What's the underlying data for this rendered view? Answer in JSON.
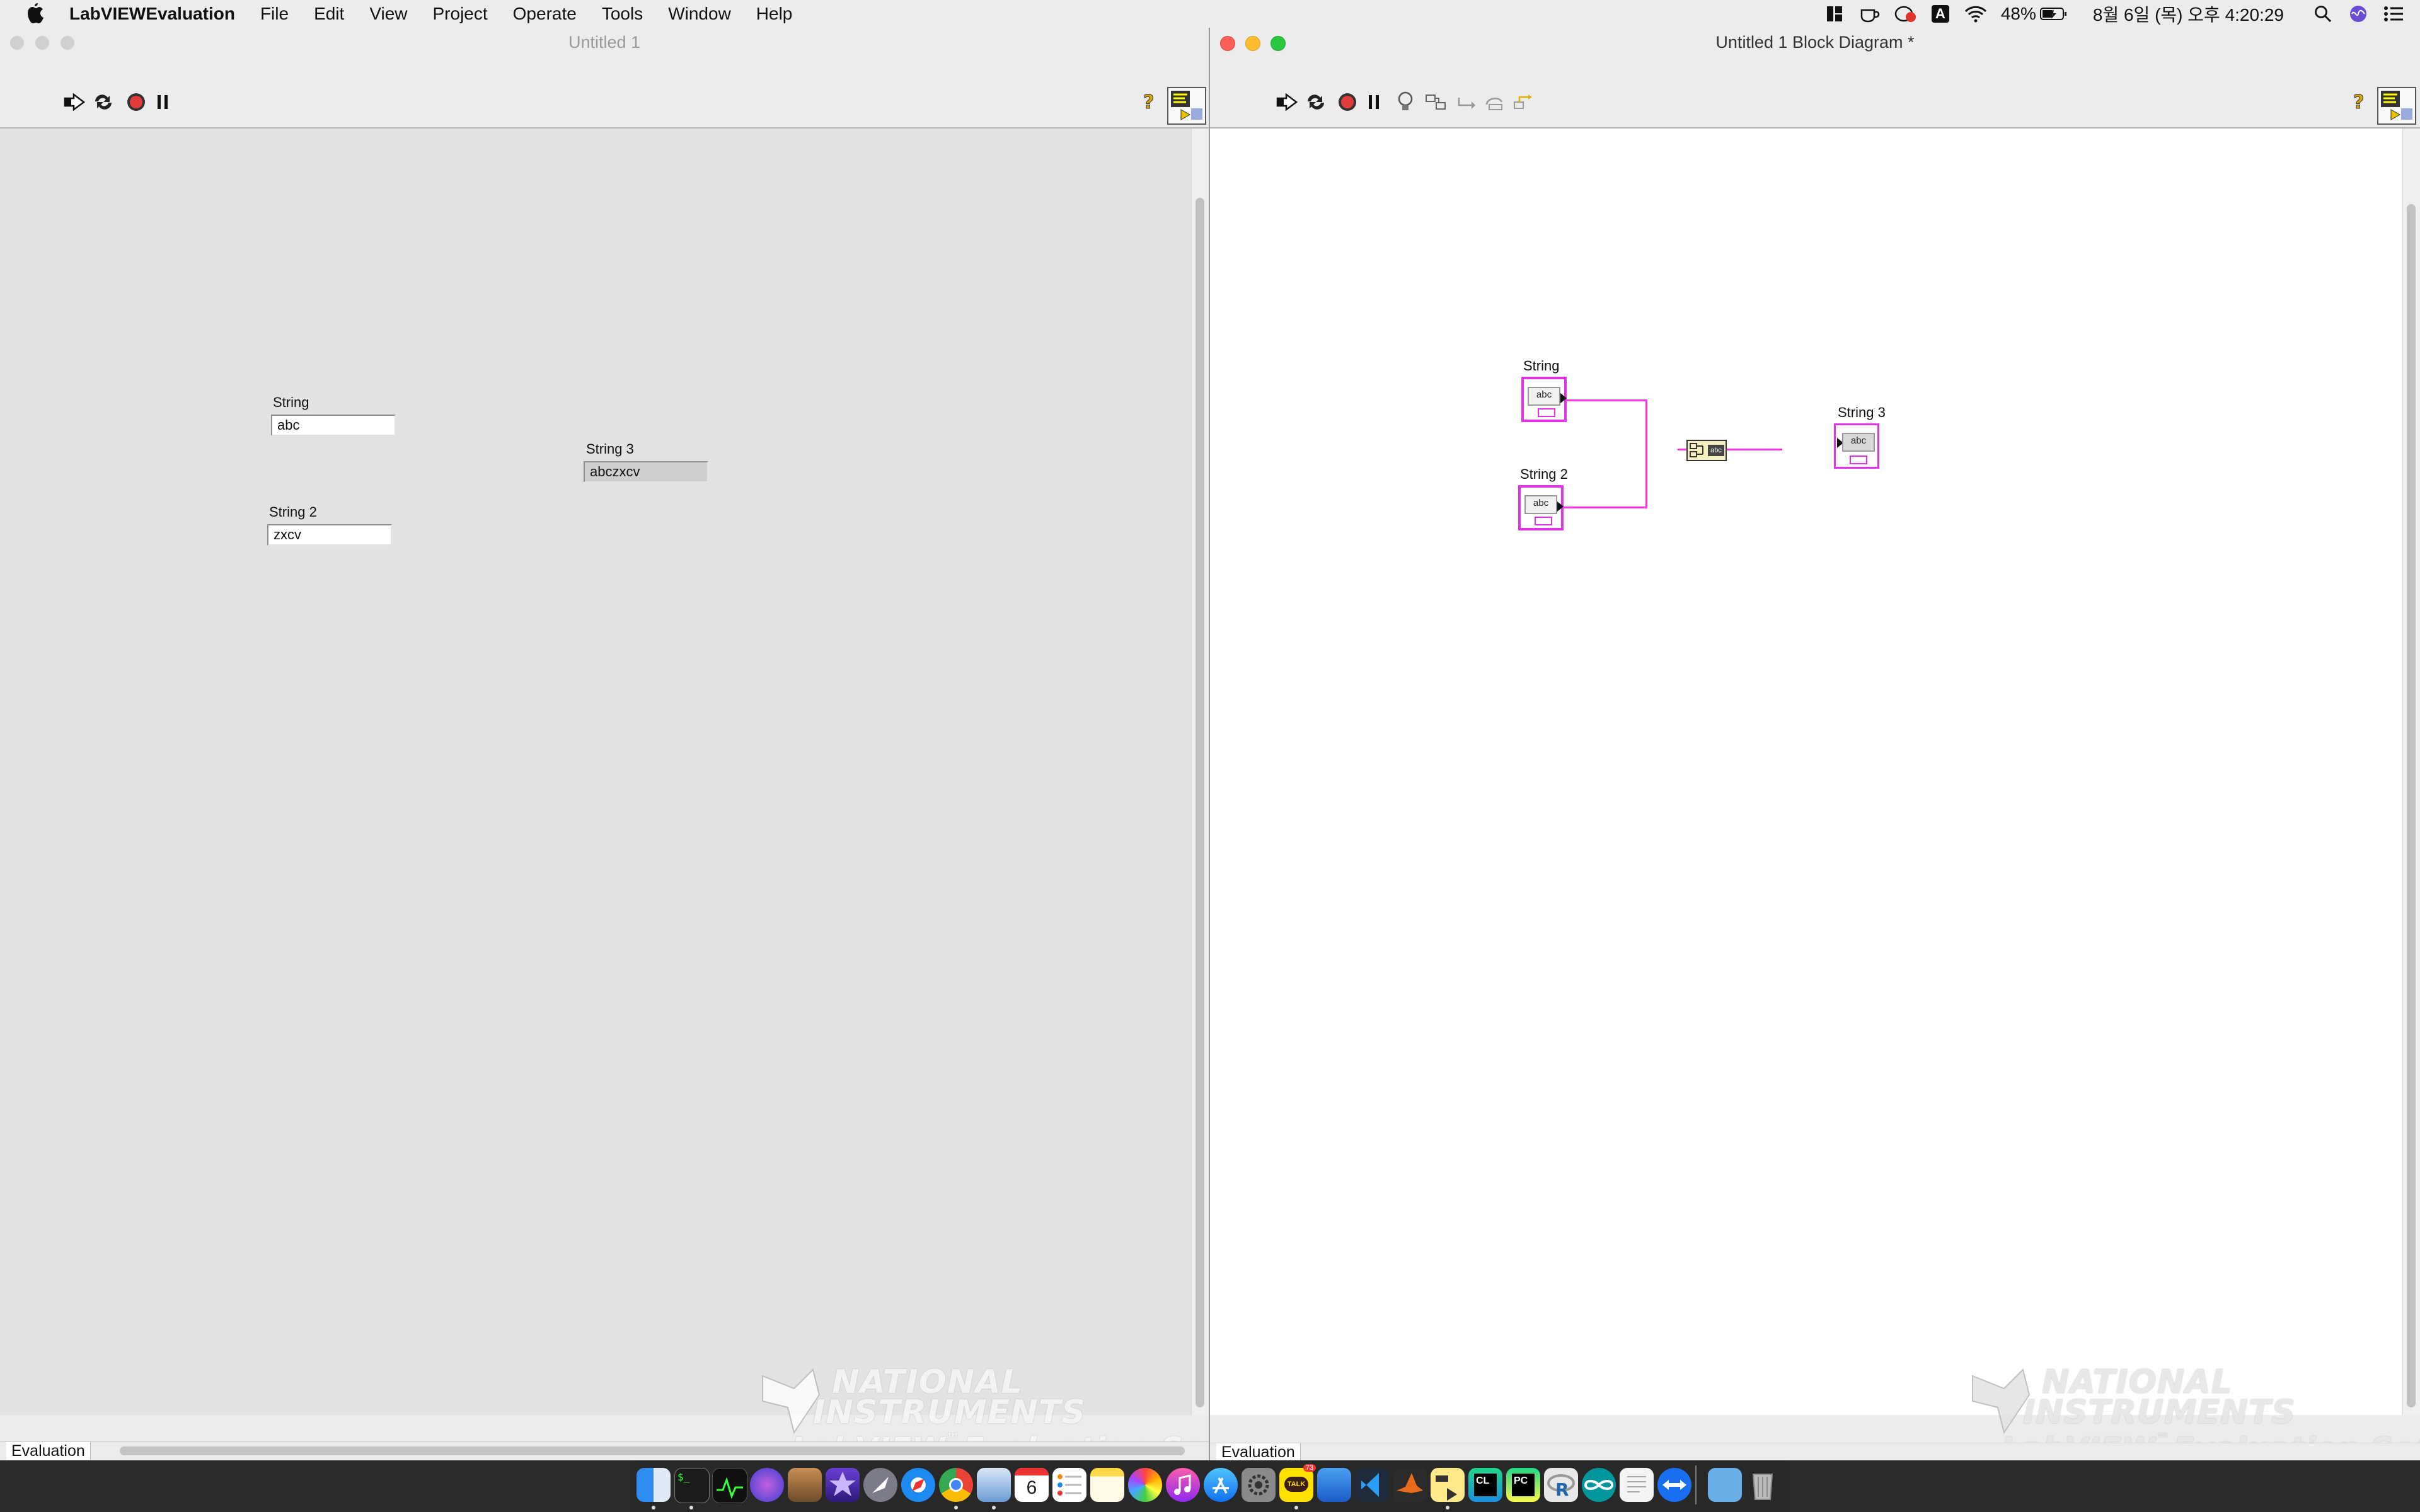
{
  "menubar": {
    "app_name": "LabVIEWEvaluation",
    "items": [
      "File",
      "Edit",
      "View",
      "Project",
      "Operate",
      "Tools",
      "Window",
      "Help"
    ],
    "battery": "48%",
    "datetime": "8월 6일 (목) 오후 4:20:29",
    "input_source": "A"
  },
  "front_panel": {
    "title": "Untitled 1",
    "status_label": "Evaluation",
    "controls": [
      {
        "label": "String",
        "value": "abc"
      },
      {
        "label": "String 2",
        "value": "zxcv"
      }
    ],
    "indicator": {
      "label": "String 3",
      "value": "abczxcv"
    },
    "watermark": {
      "line1": "NATIONAL",
      "line2": "INSTRUMENTS",
      "line3": "LabVIEW",
      "line3_suffix": "Evaluation Software",
      "tm": "™"
    }
  },
  "block_diagram": {
    "title": "Untitled 1 Block Diagram *",
    "status_label": "Evaluation",
    "terminals": [
      {
        "label": "String",
        "text": "abc"
      },
      {
        "label": "String 2",
        "text": "abc"
      },
      {
        "label": "String 3",
        "text": "abc"
      }
    ],
    "concat_node_text": "abc",
    "wire_color": "#ff33e6"
  },
  "colors": {
    "close": "#ff5f57",
    "minimize": "#febc2e",
    "zoom": "#28c840",
    "inactive": "#d0d0d0",
    "panel_bg": "#e2e2e2",
    "diagram_bg": "#ffffff",
    "terminal_pink": "#e033e6"
  },
  "dock": {
    "apps": [
      "finder-icon",
      "terminal-icon",
      "activity-monitor-icon",
      "siri-icon",
      "script-editor-icon",
      "imovie-icon",
      "launchpad-icon",
      "safari-icon",
      "chrome-icon",
      "preview-icon",
      "calendar-icon",
      "reminders-icon",
      "notes-icon",
      "photos-icon",
      "music-icon",
      "app-store-icon",
      "system-preferences-icon",
      "kakaotalk-icon",
      "finder2-icon",
      "vscode-icon",
      "matlab-icon",
      "labview-icon",
      "clion-icon",
      "pycharm-icon",
      "r-icon",
      "arduino-icon",
      "textedit-icon",
      "teamviewer-icon",
      "downloads-folder-icon",
      "trash-icon"
    ],
    "calendar_day": "6",
    "notification_badge": "73"
  }
}
